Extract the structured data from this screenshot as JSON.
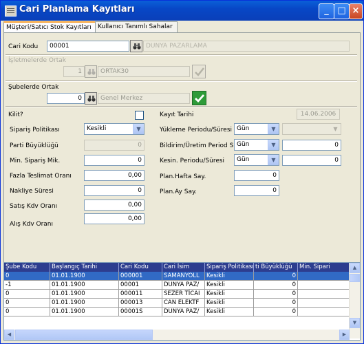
{
  "window": {
    "title": "Cari Planlama Kayıtları"
  },
  "tabs": [
    {
      "label": "Müşteri/Satıcı Stok Kayıtları"
    },
    {
      "label": "Kullanıcı Tanımlı Sahalar"
    }
  ],
  "form": {
    "cari_kodu": {
      "label": "Cari Kodu",
      "value": "00001",
      "name": "DUNYA PAZARLAMA"
    },
    "isletme_ortak": {
      "label": "İşletmelerde Ortak",
      "value": "1",
      "name": "ORTAK30"
    },
    "sube_ortak": {
      "label": "Şubelerde Ortak",
      "value": "0",
      "name": "Genel Merkez"
    },
    "kilit": {
      "label": "Kilit?",
      "checked": false
    },
    "siparis_politikasi": {
      "label": "Sipariş Politikası",
      "value": "Kesikli"
    },
    "parti_buyuklugu": {
      "label": "Parti Büyüklüğü",
      "value": "0"
    },
    "min_siparis": {
      "label": "Min. Sipariş Mik.",
      "value": "0"
    },
    "fazla_teslimat": {
      "label": "Fazla Teslimat Oranı",
      "value": "0,00"
    },
    "nakliye_suresi": {
      "label": "Nakliye Süresi",
      "value": "0"
    },
    "satis_kdv": {
      "label": "Satış Kdv Oranı",
      "value": "0,00"
    },
    "alis_kdv": {
      "label": "Alış Kdv Oranı",
      "value": "0,00"
    },
    "kayit_tarihi": {
      "label": "Kayıt Tarihi",
      "value": "14.06.2006"
    },
    "yukleme_periodu": {
      "label": "Yükleme Periodu/Süresi",
      "unit": "Gün",
      "value": ""
    },
    "bildirim_uretim": {
      "label": "Bildirim/Üretim Period S.",
      "unit": "Gün",
      "value": "0"
    },
    "kesin_periodu": {
      "label": "Kesin. Periodu/Süresi",
      "unit": "Gün",
      "value": "0"
    },
    "plan_hafta": {
      "label": "Plan.Hafta Say.",
      "value": "0"
    },
    "plan_ay": {
      "label": "Plan.Ay Say.",
      "value": "0"
    }
  },
  "grid": {
    "columns": [
      "Şube Kodu",
      "Başlangıç Tarihi",
      "Cari Kodu",
      "Cari İsim",
      "Sipariş Politikası",
      "ti Büyüklüğü",
      "Min. Sipari"
    ],
    "rows": [
      [
        "0",
        "01.01.1900",
        "000001",
        "SAMANYOLL",
        "Kesikli",
        "0",
        ""
      ],
      [
        "-1",
        "01.01.1900",
        "00001",
        "DUNYA PAZ/",
        "Kesikli",
        "0",
        ""
      ],
      [
        "0",
        "01.01.1900",
        "000011",
        "SEZER TİCAI",
        "Kesikli",
        "0",
        ""
      ],
      [
        "0",
        "01.01.1900",
        "000013",
        "CAN ELEKTF",
        "Kesikli",
        "0",
        ""
      ],
      [
        "0",
        "01.01.1900",
        "00001S",
        "DUNYA PAZ/",
        "Kesikli",
        "0",
        ""
      ]
    ]
  },
  "colors": {
    "titlebar": "#0a5fd8",
    "grid_header": "#2d3d8f",
    "selected_row": "#316ac5"
  }
}
